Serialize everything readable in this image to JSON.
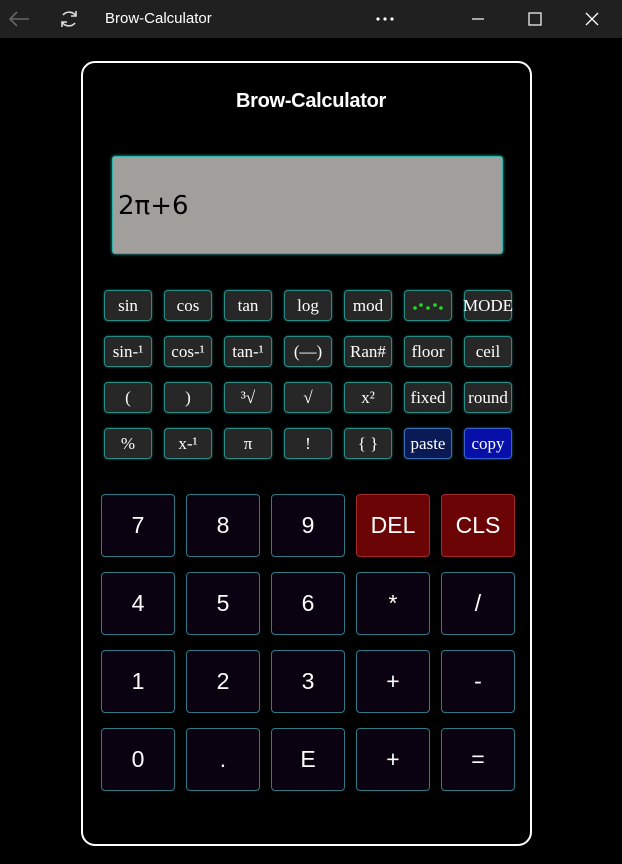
{
  "window": {
    "title": "Brow-Calculator"
  },
  "app": {
    "title": "Brow-Calculator",
    "display_value": "2π+6"
  },
  "sci_rows": [
    [
      "sin",
      "cos",
      "tan",
      "log",
      "mod",
      "",
      "MODE"
    ],
    [
      "sin-¹",
      "cos-¹",
      "tan-¹",
      "(—)",
      "Ran#",
      "floor",
      "ceil"
    ],
    [
      "(",
      ")",
      "³√",
      "√",
      "x²",
      "fixed",
      "round"
    ],
    [
      "%",
      "x-¹",
      "π",
      "!",
      "{ }",
      "paste",
      "copy"
    ]
  ],
  "keypad_rows": [
    [
      "7",
      "8",
      "9",
      "DEL",
      "CLS"
    ],
    [
      "4",
      "5",
      "6",
      "*",
      "/"
    ],
    [
      "1",
      "2",
      "3",
      "+",
      "-"
    ],
    [
      "0",
      ".",
      "E",
      "+",
      "="
    ]
  ],
  "colors": {
    "display_bg": "#a19f9c",
    "red_key": "#6b0505",
    "dots_green": "#22dd22",
    "paste_bg": "#0a1a55",
    "copy_bg": "#0610a8"
  },
  "icons": {
    "back": "back-arrow-icon",
    "refresh": "refresh-icon",
    "more": "more-icon",
    "minimize": "minimize-icon",
    "maximize": "maximize-icon",
    "close": "close-icon",
    "dots": "dots-indicator-icon"
  }
}
